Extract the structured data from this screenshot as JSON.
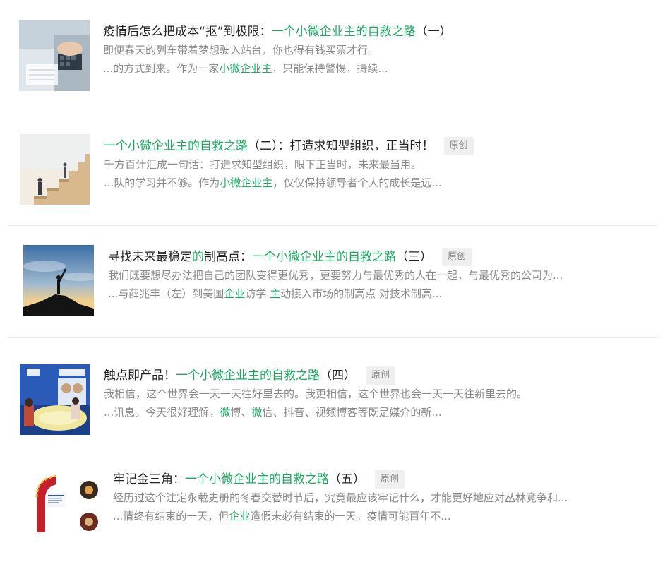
{
  "articles": [
    {
      "title_pre": "疫情后怎么把成本“抠”到极限：",
      "title_hl": "一个小微企业主的自救之路",
      "title_post": "（一）",
      "badge": "",
      "desc": "即便春天的列车带着梦想驶入站台，你也得有钱买票才行。",
      "snippet": [
        {
          "t": "...的方式到来。作为一家",
          "h": false
        },
        {
          "t": "小微企业主",
          "h": true
        },
        {
          "t": "，只能保持警惕，持续...",
          "h": false
        }
      ]
    },
    {
      "title_pre": "",
      "title_hl": "一个小微企业主的自救之路",
      "title_post": "（二）：打造求知型组织，正当时！",
      "badge": "原创",
      "desc": "千方百计汇成一句话：打造求知型组织，眼下正当时，未来最当用。",
      "snippet": [
        {
          "t": "...队的学习并不够。作为",
          "h": false
        },
        {
          "t": "小微企业主",
          "h": true
        },
        {
          "t": "，仅仅保持领导者个人的成长是远...",
          "h": false
        }
      ]
    },
    {
      "title_pre": "寻找未来最稳定",
      "title_hl_small": "的",
      "title_mid": "制高点：",
      "title_hl": "一个小微企业主的自救之路",
      "title_post": "（三）",
      "badge": "原创",
      "desc": "我们既要想尽办法把自己的团队变得更优秀，更要努力与最优秀的人在一起，与最优秀的公司为...",
      "snippet": [
        {
          "t": "...与薛兆丰（左）到美国",
          "h": false
        },
        {
          "t": "企业",
          "h": true
        },
        {
          "t": "访学 ",
          "h": false
        },
        {
          "t": "主",
          "h": true
        },
        {
          "t": "动接入市场的制高点 对技术制高...",
          "h": false
        }
      ]
    },
    {
      "title_pre": "触点即产品！",
      "title_hl": "一个小微企业主的自救之路",
      "title_post": "（四）",
      "badge": "原创",
      "desc": "我相信，这个世界会一天一天往好里去的。我更相信，这个世界也会一天一天往新里去的。",
      "snippet": [
        {
          "t": "...讯息。今天很好理解，",
          "h": false
        },
        {
          "t": "微",
          "h": true
        },
        {
          "t": "博、",
          "h": false
        },
        {
          "t": "微",
          "h": true
        },
        {
          "t": "信、抖音、视频博客等既是媒介的新...",
          "h": false
        }
      ]
    },
    {
      "title_pre": "牢记金三角：",
      "title_hl": "一个小微企业主的自救之路",
      "title_post": "（五）",
      "badge": "原创",
      "desc": "经历过这个注定永载史册的冬春交替时节后，究竟最应该牢记什么，才能更好地应对丛林竞争和...",
      "snippet": [
        {
          "t": "...情终有结束的一天，但",
          "h": false
        },
        {
          "t": "企业",
          "h": true
        },
        {
          "t": "造假未必有结束的一天。疫情可能百年不...",
          "h": false
        }
      ]
    }
  ],
  "colors": {
    "highlight": "#1aad5f",
    "title": "#222222",
    "desc": "#8a8a8a",
    "badge_bg": "#efefef"
  }
}
